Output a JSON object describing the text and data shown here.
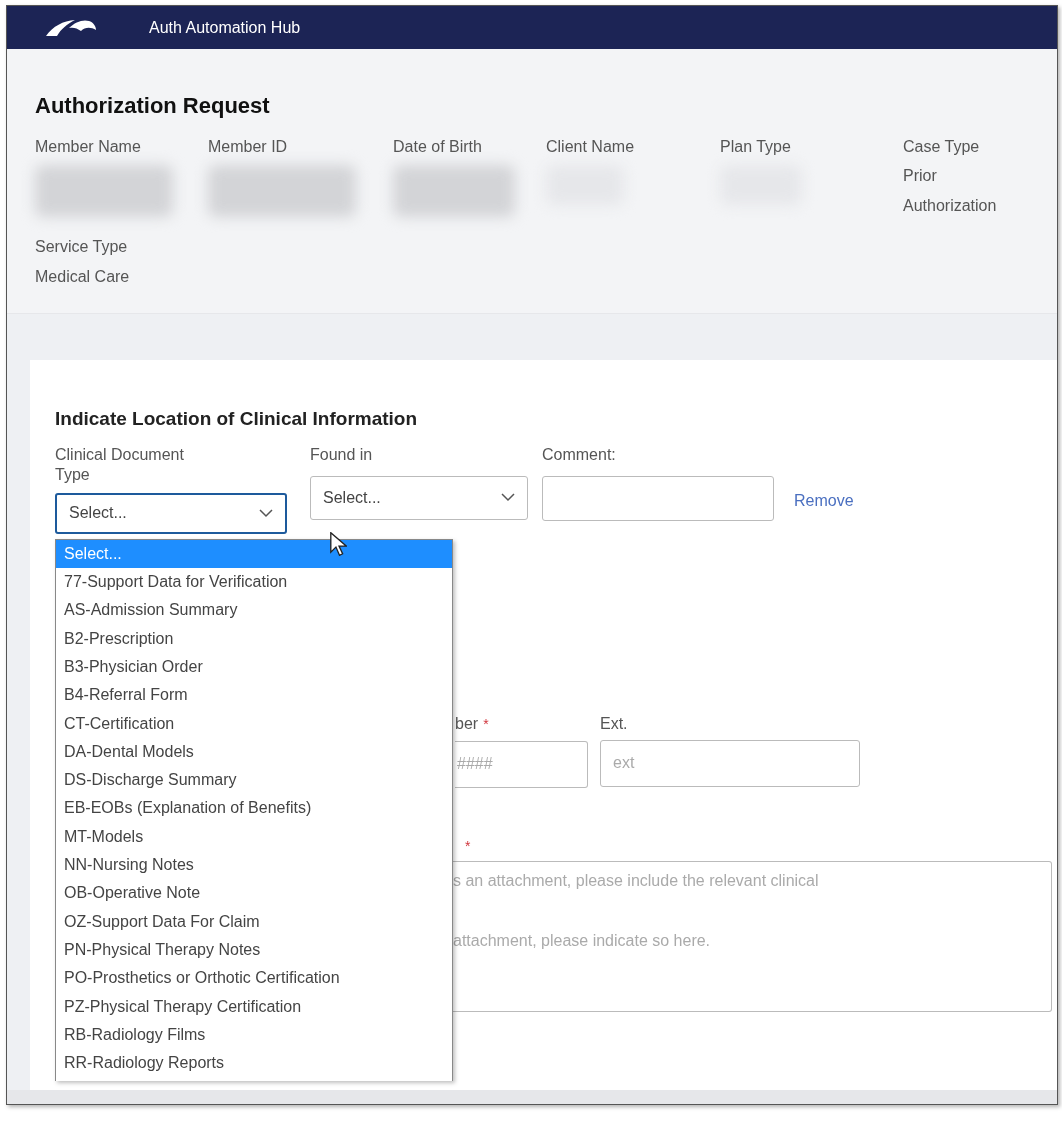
{
  "app": {
    "title": "Auth Automation Hub"
  },
  "header": {
    "title": "Authorization Request",
    "fields": [
      {
        "label": "Member Name",
        "redacted": true
      },
      {
        "label": "Member ID",
        "redacted": true
      },
      {
        "label": "Date of Birth",
        "redacted": true
      },
      {
        "label": "Client Name",
        "redacted": true
      },
      {
        "label": "Plan Type",
        "redacted": true
      },
      {
        "label": "Case Type",
        "value": "Prior Authorization"
      }
    ],
    "service": {
      "label": "Service Type",
      "value": "Medical Care"
    }
  },
  "clinical_section": {
    "title": "Indicate Location of Clinical Information",
    "document_type": {
      "label": "Clinical Document Type",
      "value": "Select...",
      "focused": true,
      "expanded": true,
      "options": [
        {
          "label": "Select...",
          "selected": true
        },
        {
          "label": "77-Support Data for Verification",
          "selected": false
        },
        {
          "label": "AS-Admission Summary",
          "selected": false
        },
        {
          "label": "B2-Prescription",
          "selected": false
        },
        {
          "label": "B3-Physician Order",
          "selected": false
        },
        {
          "label": "B4-Referral Form",
          "selected": false
        },
        {
          "label": "CT-Certification",
          "selected": false
        },
        {
          "label": "DA-Dental Models",
          "selected": false
        },
        {
          "label": "DS-Discharge Summary",
          "selected": false
        },
        {
          "label": "EB-EOBs (Explanation of Benefits)",
          "selected": false
        },
        {
          "label": "MT-Models",
          "selected": false
        },
        {
          "label": "NN-Nursing Notes",
          "selected": false
        },
        {
          "label": "OB-Operative Note",
          "selected": false
        },
        {
          "label": "OZ-Support Data For Claim",
          "selected": false
        },
        {
          "label": "PN-Physical Therapy Notes",
          "selected": false
        },
        {
          "label": "PO-Prosthetics or Orthotic Certification",
          "selected": false
        },
        {
          "label": "PZ-Physical Therapy Certification",
          "selected": false
        },
        {
          "label": "RB-Radiology Films",
          "selected": false
        },
        {
          "label": "RR-Radiology Reports",
          "selected": false
        }
      ]
    },
    "found_in": {
      "label": "Found in",
      "value": "Select..."
    },
    "comment": {
      "label": "Comment:"
    },
    "remove_link": "Remove"
  },
  "contact_section": {
    "phone": {
      "label": "ber",
      "required_mark": "*",
      "placeholder": "####"
    },
    "ext": {
      "label": "Ext.",
      "placeholder": "ext"
    }
  },
  "notes": {
    "required_mark": "*",
    "placeholder": "s an attachment, please include the relevant clinical\n\nattachment, please indicate so here."
  }
}
